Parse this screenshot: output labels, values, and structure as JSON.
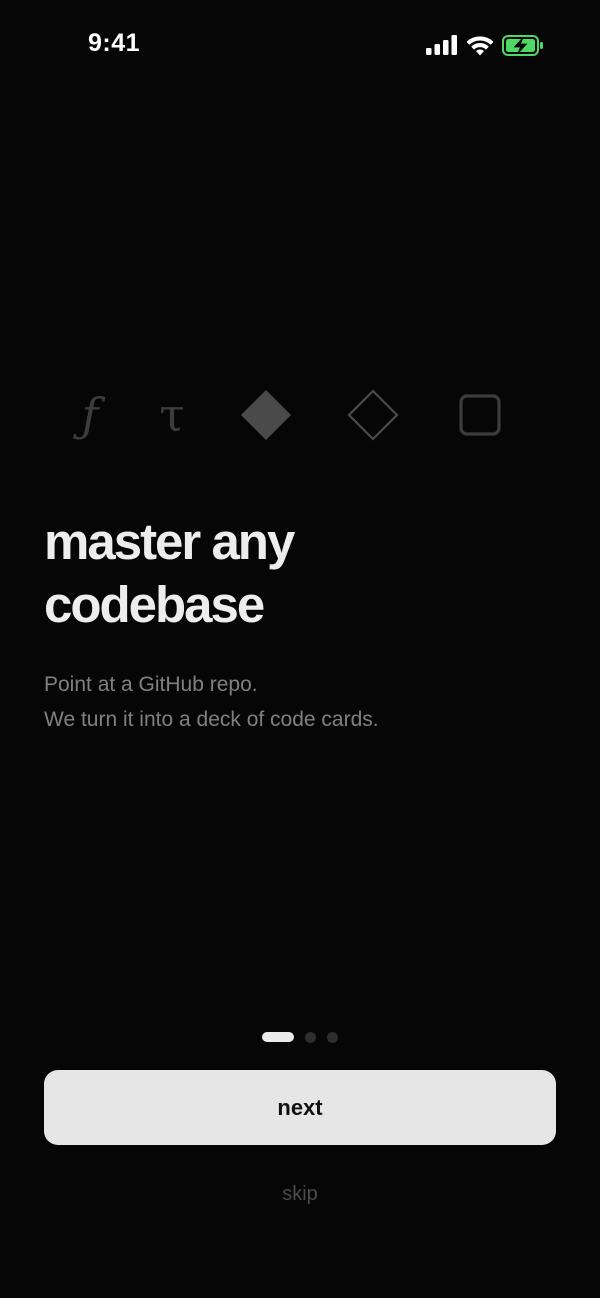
{
  "status_bar": {
    "time": "9:41",
    "icons": [
      "cellular-signal-icon",
      "wifi-icon",
      "battery-charging-icon"
    ],
    "battery_color": "#4cd964"
  },
  "onboarding": {
    "icons": [
      {
        "name": "function-icon",
        "glyph": "ƒ"
      },
      {
        "name": "tau-icon",
        "glyph": "τ"
      },
      {
        "name": "filled-diamond-icon"
      },
      {
        "name": "outline-diamond-icon"
      },
      {
        "name": "rounded-square-icon"
      }
    ],
    "headline_line1": "master any",
    "headline_line2": "codebase",
    "subtitle_line1": "Point at a GitHub repo.",
    "subtitle_line2": "We turn it into a deck of code cards.",
    "page_indicator": {
      "current": 1,
      "total": 3
    },
    "next_label": "next",
    "skip_label": "skip"
  },
  "colors": {
    "background": "#060606",
    "headline": "#ededed",
    "subtitle": "#808080",
    "button_bg": "#e6e6e6",
    "button_text": "#111111",
    "skip": "#4a4a4a"
  }
}
